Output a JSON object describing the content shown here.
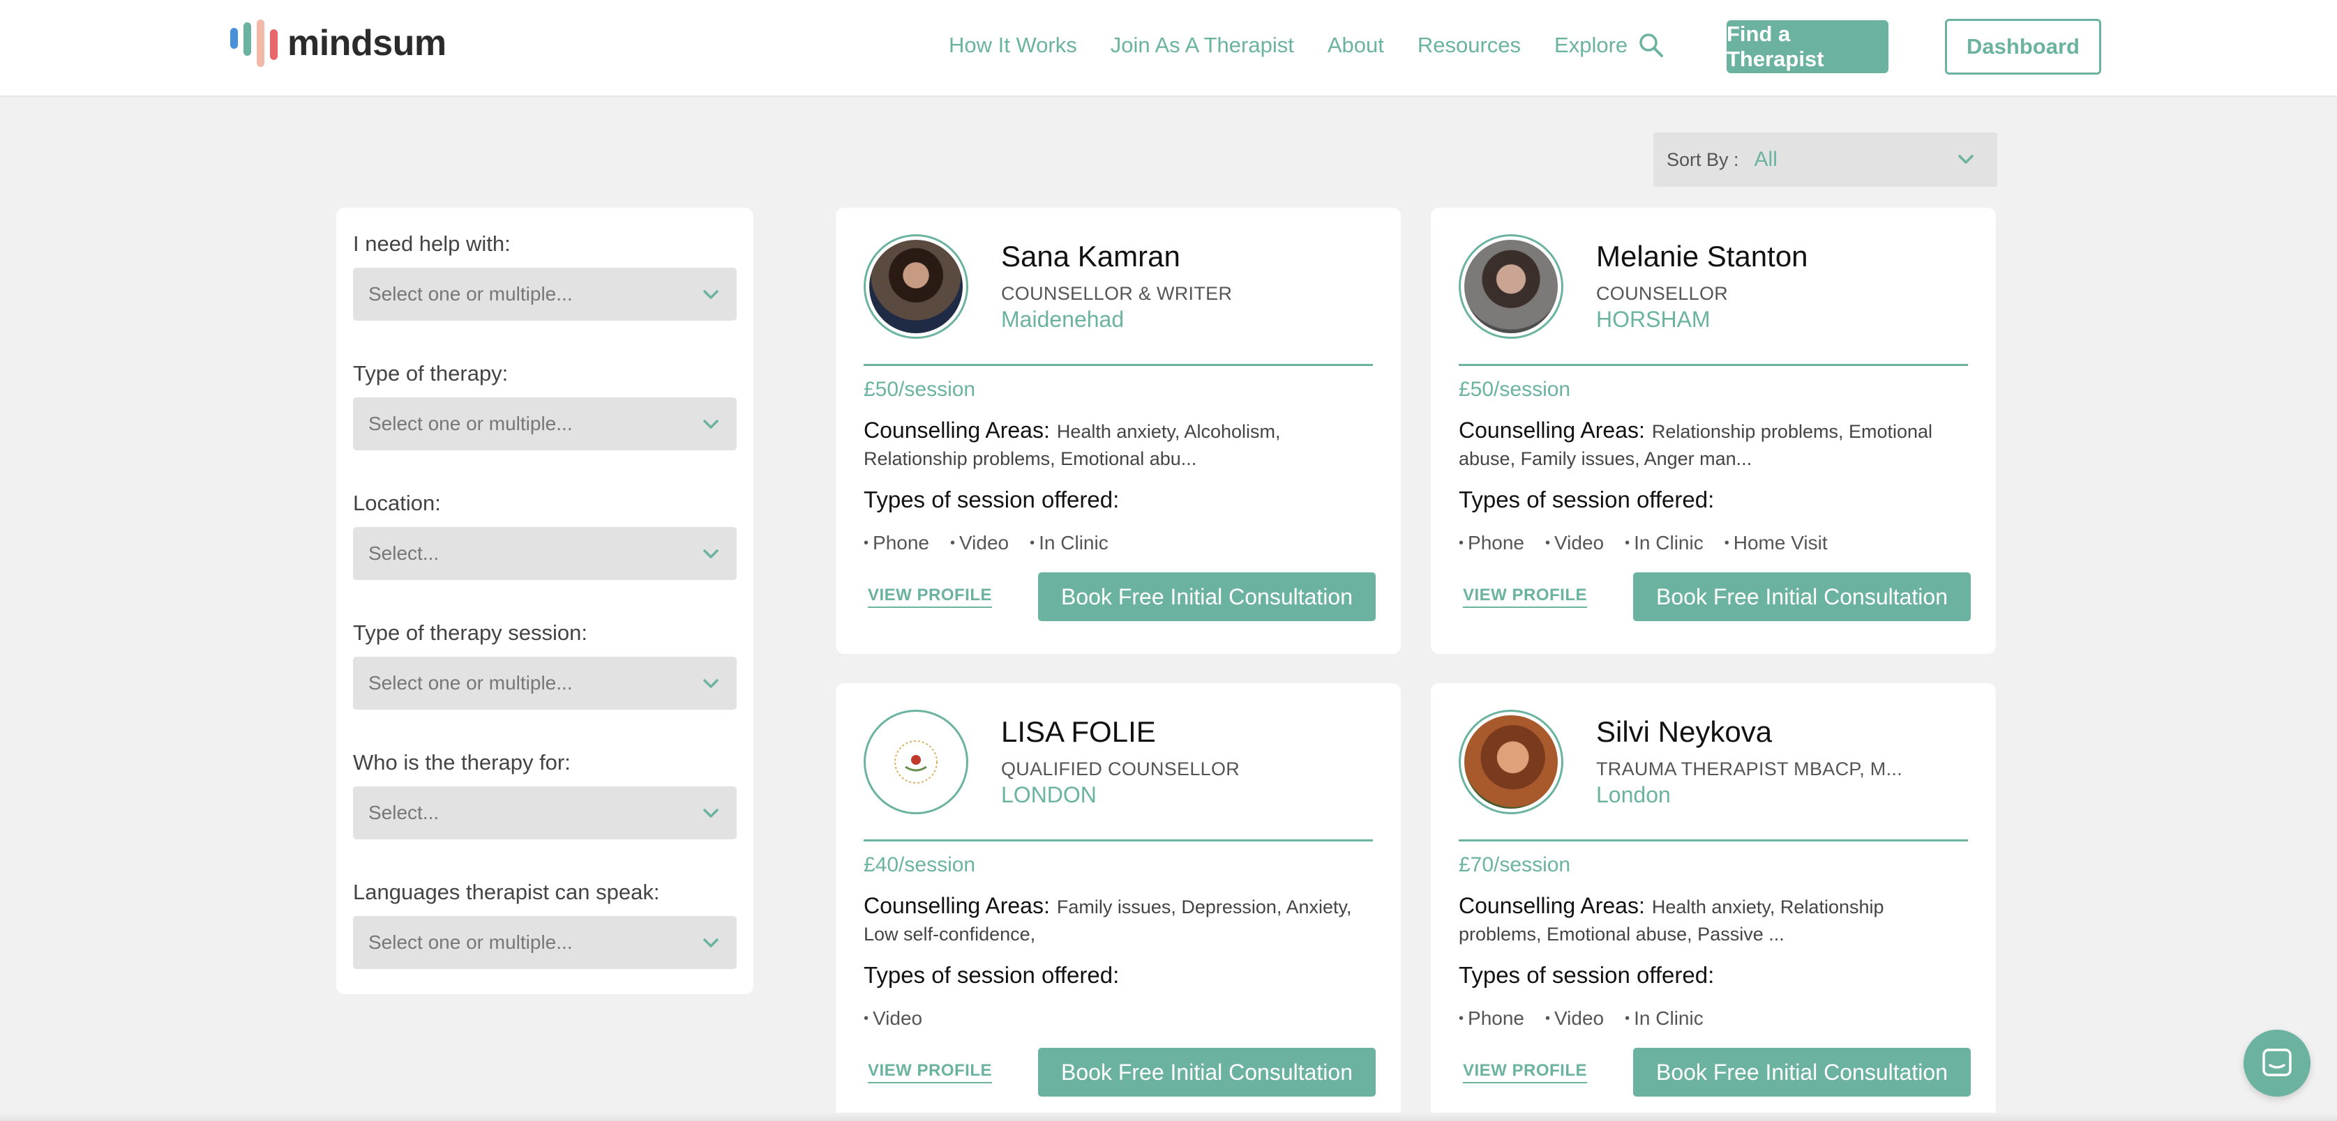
{
  "brand": {
    "name": "mindsum",
    "bar_colors": [
      "#4a90d9",
      "#6bb3a0",
      "#f2b8a8",
      "#e8676b"
    ]
  },
  "nav": {
    "links": [
      "How It Works",
      "Join As A Therapist",
      "About",
      "Resources"
    ],
    "explore": "Explore",
    "find_therapist": "Find a Therapist",
    "dashboard": "Dashboard"
  },
  "sort": {
    "label": "Sort By :",
    "value": "All"
  },
  "filters": [
    {
      "label": "I need help with:",
      "placeholder": "Select one or multiple..."
    },
    {
      "label": "Type of therapy:",
      "placeholder": "Select one or multiple..."
    },
    {
      "label": "Location:",
      "placeholder": "Select..."
    },
    {
      "label": "Type of therapy session:",
      "placeholder": "Select one or multiple..."
    },
    {
      "label": "Who is the therapy for:",
      "placeholder": "Select..."
    },
    {
      "label": "Languages therapist can speak:",
      "placeholder": "Select one or multiple..."
    }
  ],
  "card_common": {
    "areas_label": "Counselling Areas:",
    "types_label": "Types of session offered:",
    "view_profile": "VIEW PROFILE",
    "book": "Book Free Initial Consultation"
  },
  "therapists": [
    {
      "name": "Sana Kamran",
      "title": "COUNSELLOR & WRITER",
      "city": "Maidenehad",
      "price": "£50/session",
      "areas": "Health anxiety, Alcoholism, Relationship problems, Emotional abu...",
      "sessions": [
        "Phone",
        "Video",
        "In Clinic"
      ]
    },
    {
      "name": "Melanie Stanton",
      "title": "COUNSELLOR",
      "city": "HORSHAM",
      "price": "£50/session",
      "areas": "Relationship problems, Emotional abuse, Family issues, Anger man...",
      "sessions": [
        "Phone",
        "Video",
        "In Clinic",
        "Home Visit"
      ]
    },
    {
      "name": "LISA FOLIE",
      "title": "QUALIFIED COUNSELLOR",
      "city": "LONDON",
      "price": "£40/session",
      "areas": "Family issues, Depression, Anxiety, Low self-confidence,",
      "sessions": [
        "Video"
      ]
    },
    {
      "name": "Silvi Neykova",
      "title": "TRAUMA THERAPIST MBACP, M...",
      "city": "London",
      "price": "£70/session",
      "areas": "Health anxiety, Relationship problems, Emotional abuse, Passive ...",
      "sessions": [
        "Phone",
        "Video",
        "In Clinic"
      ]
    }
  ],
  "accent_color": "#6bb3a0",
  "icons": [
    "search-icon",
    "chevron-down-icon",
    "chat-icon"
  ]
}
